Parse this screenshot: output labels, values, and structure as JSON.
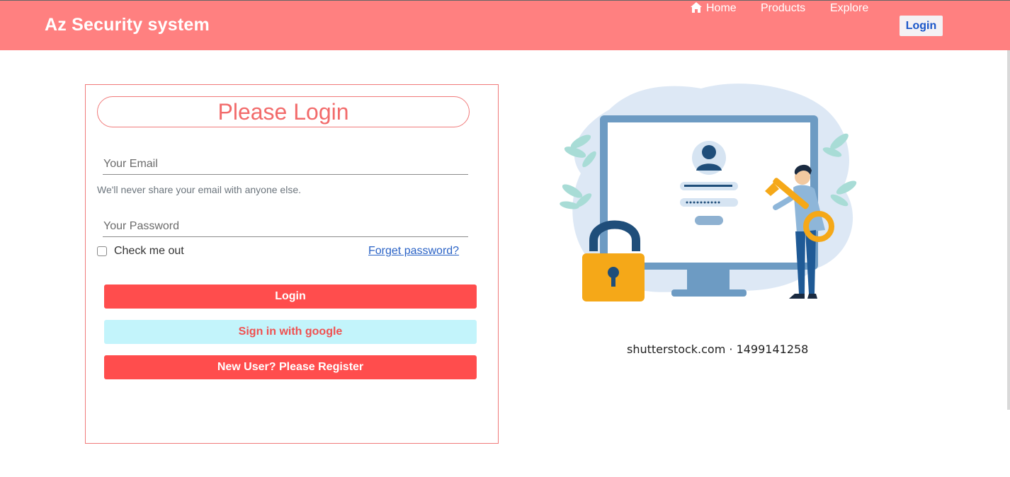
{
  "navbar": {
    "brand": "Az Security system",
    "links": {
      "home": "Home",
      "products": "Products",
      "explore": "Explore",
      "login": "Login"
    }
  },
  "login_form": {
    "title": "Please Login",
    "email_placeholder": "Your Email",
    "email_help": "We'll never share your email with anyone else.",
    "password_placeholder": "Your Password",
    "remember_label": "Check me out",
    "remember_checked": false,
    "forgot_link": "Forget password?",
    "login_button": "Login",
    "google_button": "Sign in with google",
    "register_button": "New User? Please Register"
  },
  "illustration": {
    "caption": "shutterstock.com · 1499141258"
  },
  "colors": {
    "navbar": "#ff8080",
    "primary_button": "#ff4d4d",
    "google_button": "#c3f4fb",
    "title": "#f26b6b",
    "link": "#2b63c6"
  }
}
